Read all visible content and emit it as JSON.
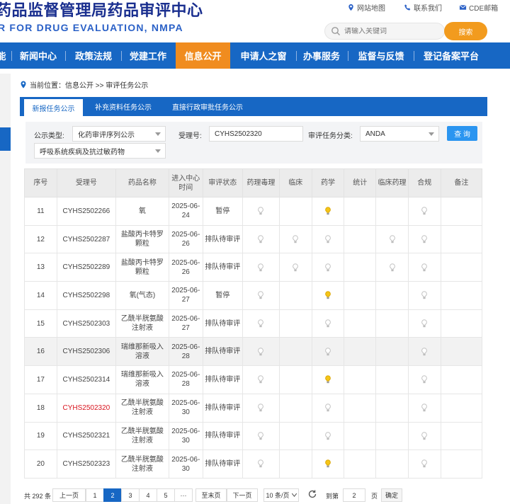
{
  "header": {
    "title": "药品监督管理局药品审评中心",
    "subtitle": "R FOR DRUG EVALUATION, NMPA",
    "top_links": [
      "网站地图",
      "联系我们",
      "CDE邮箱"
    ],
    "search_placeholder": "请输入关键词",
    "search_button": "搜索"
  },
  "nav": {
    "items": [
      "新闻中心",
      "政策法规",
      "党建工作",
      "信息公开",
      "申请人之窗",
      "办事服务",
      "监督与反馈",
      "登记备案平台"
    ],
    "active": "信息公开",
    "partial_left": "能"
  },
  "breadcrumb": {
    "prefix": "当前位置：",
    "path": "信息公开 >> 审评任务公示"
  },
  "tabs": [
    "新报任务公示",
    "补充资料任务公示",
    "直接行政审批任务公示"
  ],
  "filter": {
    "type_label": "公示类型:",
    "type_value": "化药审评序列公示",
    "accept_label": "受理号:",
    "accept_value": "CYHS2502320",
    "category_label": "审评任务分类:",
    "category_value": "ANDA",
    "query_button": "查 询",
    "second_select": "呼吸系统疾病及抗过敏药物"
  },
  "table": {
    "columns": [
      "序号",
      "受理号",
      "药品名称",
      "进入中心时间",
      "审评状态",
      "药理毒理",
      "临床",
      "药学",
      "统计",
      "临床药理",
      "合规",
      "备注"
    ],
    "rows": [
      {
        "no": "11",
        "id": "CYHS2502266",
        "name": "氧",
        "date": "2025-06-24",
        "status": "暂停",
        "cells": [
          "grey",
          "",
          "yellow",
          "",
          "",
          "grey",
          ""
        ]
      },
      {
        "no": "12",
        "id": "CYHS2502287",
        "name": "盐酸丙卡特罗颗粒",
        "date": "2025-06-26",
        "status": "排队待审评",
        "cells": [
          "grey",
          "grey",
          "grey",
          "",
          "grey",
          "grey",
          ""
        ]
      },
      {
        "no": "13",
        "id": "CYHS2502289",
        "name": "盐酸丙卡特罗颗粒",
        "date": "2025-06-26",
        "status": "排队待审评",
        "cells": [
          "grey",
          "grey",
          "grey",
          "",
          "grey",
          "grey",
          ""
        ]
      },
      {
        "no": "14",
        "id": "CYHS2502298",
        "name": "氧(气态)",
        "date": "2025-06-27",
        "status": "暂停",
        "cells": [
          "grey",
          "",
          "yellow",
          "",
          "",
          "grey",
          ""
        ]
      },
      {
        "no": "15",
        "id": "CYHS2502303",
        "name": "乙酰半胱氨酸注射液",
        "date": "2025-06-27",
        "status": "排队待审评",
        "cells": [
          "grey",
          "",
          "grey",
          "",
          "",
          "grey",
          ""
        ]
      },
      {
        "no": "16",
        "id": "CYHS2502306",
        "name": "瑞维那新吸入溶液",
        "date": "2025-06-28",
        "status": "排队待审评",
        "cells": [
          "grey",
          "",
          "grey",
          "",
          "",
          "grey",
          ""
        ]
      },
      {
        "no": "17",
        "id": "CYHS2502314",
        "name": "瑞维那新吸入溶液",
        "date": "2025-06-28",
        "status": "排队待审评",
        "cells": [
          "grey",
          "",
          "yellow",
          "",
          "",
          "grey",
          ""
        ]
      },
      {
        "no": "18",
        "id": "CYHS2502320",
        "name": "乙酰半胱氨酸注射液",
        "date": "2025-06-30",
        "status": "排队待审评",
        "cells": [
          "grey",
          "",
          "grey",
          "",
          "",
          "grey",
          ""
        ]
      },
      {
        "no": "19",
        "id": "CYHS2502321",
        "name": "乙酰半胱氨酸注射液",
        "date": "2025-06-30",
        "status": "排队待审评",
        "cells": [
          "grey",
          "",
          "grey",
          "",
          "",
          "grey",
          ""
        ]
      },
      {
        "no": "20",
        "id": "CYHS2502323",
        "name": "乙酰半胱氨酸注射液",
        "date": "2025-06-30",
        "status": "排队待审评",
        "cells": [
          "grey",
          "",
          "yellow",
          "",
          "",
          "grey",
          ""
        ]
      }
    ],
    "highlight_row": "16",
    "highlight_id": "CYHS2502320"
  },
  "pagination": {
    "total": "共 292 条",
    "prev": "上一页",
    "pages": [
      "1",
      "2",
      "3",
      "4",
      "5",
      "···"
    ],
    "current": "2",
    "last": "至末页",
    "next": "下一页",
    "page_size": "10 条/页",
    "goto_label": "到第",
    "goto_value": "2",
    "page_unit": "页",
    "confirm": "确定"
  },
  "colors": {
    "brand_blue": "#1767c4",
    "accent_orange": "#f08c1f",
    "bulb_yellow": "#f5c518",
    "bulb_grey": "#bdbdbd",
    "highlight_red": "#d9141e"
  }
}
